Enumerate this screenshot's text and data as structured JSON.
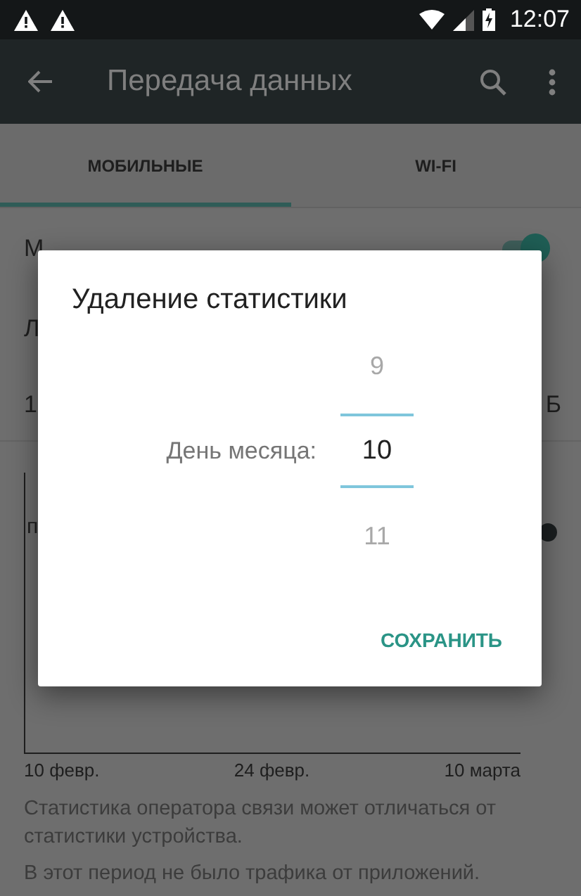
{
  "status_bar": {
    "time": "12:07"
  },
  "app_bar": {
    "title": "Передача данных"
  },
  "tabs": [
    {
      "label": "МОБИЛЬНЫЕ",
      "selected": true
    },
    {
      "label": "WI-FI",
      "selected": false
    }
  ],
  "settings": [
    {
      "kind": "switch",
      "title": "М",
      "on": true
    },
    {
      "kind": "text",
      "title": "Л"
    },
    {
      "kind": "value",
      "title": "1",
      "value": "Б"
    }
  ],
  "chart": {
    "label": "п",
    "x_labels": [
      "10 февр.",
      "24 февр.",
      "10 марта"
    ]
  },
  "notes": [
    "Статистика оператора связи может отличаться от статистики устройства.",
    "В этот период не было трафика от приложений."
  ],
  "dialog": {
    "title": "Удаление статистики",
    "label": "День месяца:",
    "options": [
      {
        "text": "9",
        "selected": false
      },
      {
        "text": "10",
        "selected": true
      },
      {
        "text": "11",
        "selected": false
      }
    ],
    "button": "СОХРАНИТЬ"
  }
}
